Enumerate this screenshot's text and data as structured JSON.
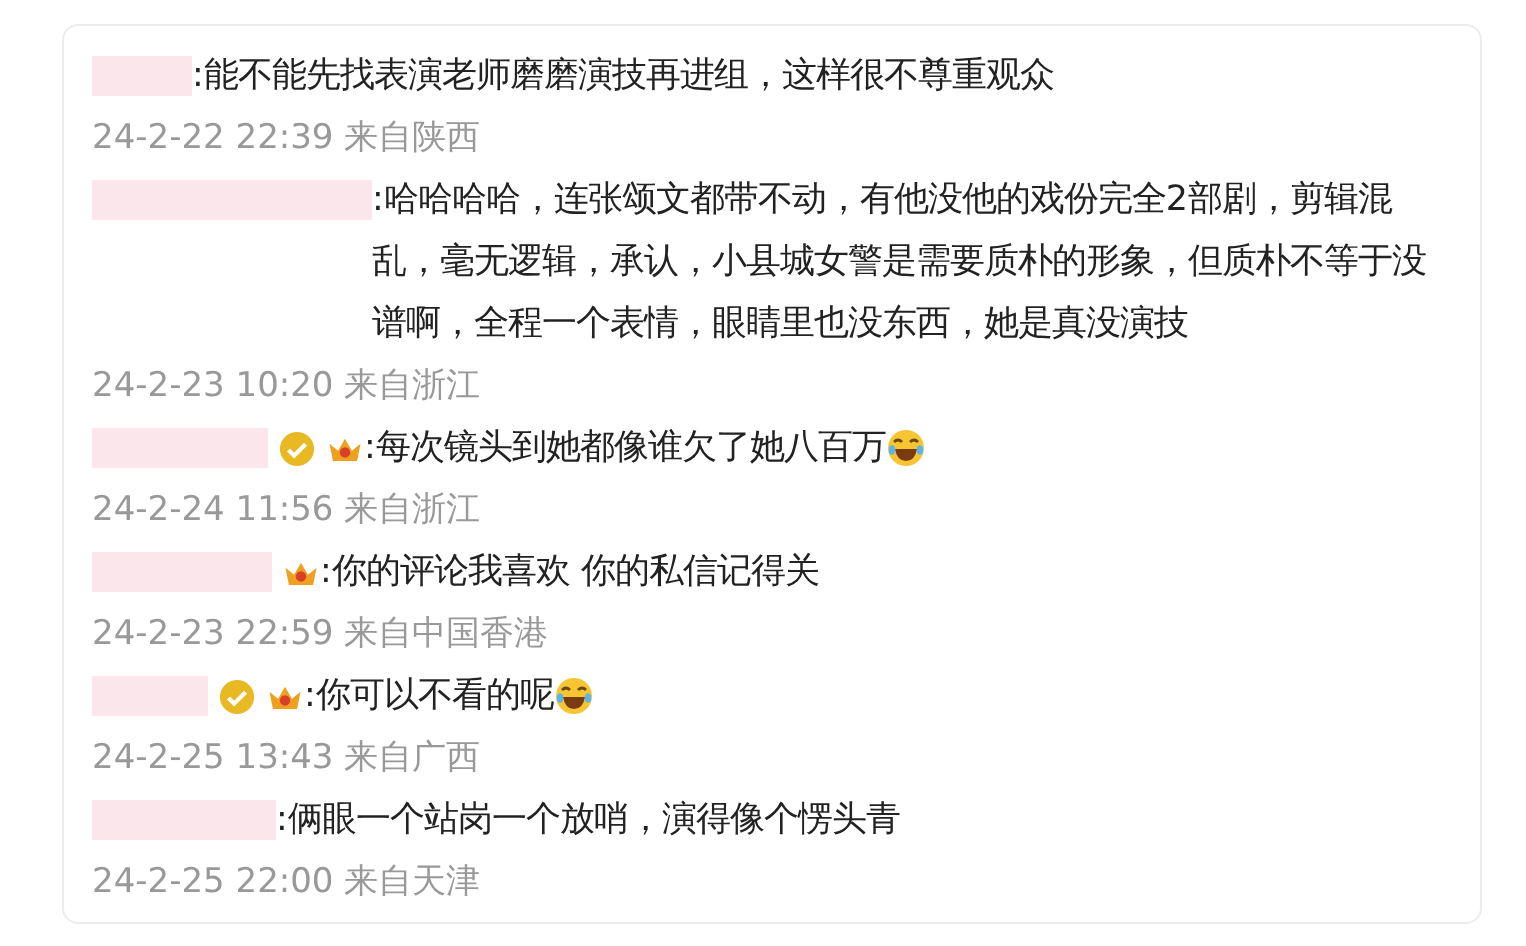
{
  "comments": [
    {
      "verified": false,
      "crown": false,
      "laughing_emoji": false,
      "text": ":能不能先找表演老师磨磨演技再进组，这样很不尊重观众",
      "meta": "24-2-22 22:39 来自陕西"
    },
    {
      "verified": false,
      "crown": false,
      "laughing_emoji": false,
      "text": ":哈哈哈哈，连张颂文都带不动，有他没他的戏份完全2部剧，剪辑混乱，毫无逻辑，承认，小县城女警是需要质朴的形象，但质朴不等于没谱啊，全程一个表情，眼睛里也没东西，她是真没演技",
      "meta": "24-2-23 10:20 来自浙江"
    },
    {
      "verified": true,
      "crown": true,
      "laughing_emoji": true,
      "text": ":每次镜头到她都像谁欠了她八百万",
      "meta": "24-2-24 11:56 来自浙江"
    },
    {
      "verified": false,
      "crown": true,
      "laughing_emoji": false,
      "text": ":你的评论我喜欢 你的私信记得关",
      "meta": "24-2-23 22:59 来自中国香港"
    },
    {
      "verified": true,
      "crown": true,
      "laughing_emoji": true,
      "text": ":你可以不看的呢",
      "meta": "24-2-25 13:43 来自广西"
    },
    {
      "verified": false,
      "crown": false,
      "laughing_emoji": false,
      "text": ":俩眼一个站岗一个放哨，演得像个愣头青",
      "meta": "24-2-25 22:00 来自天津"
    }
  ]
}
